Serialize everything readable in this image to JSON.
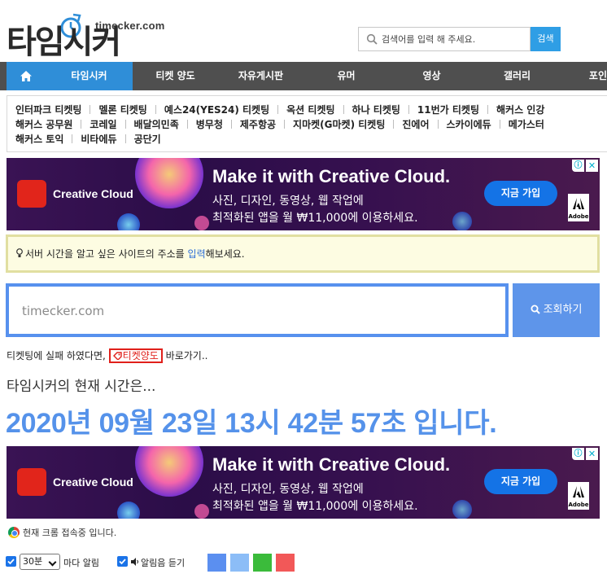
{
  "header": {
    "logo_domain": "timecker.com",
    "logo_text": "타임시커",
    "search_placeholder": "검색어를 입력 해 주세요.",
    "search_button": "검색"
  },
  "nav": {
    "home_icon": "home-icon",
    "items": [
      "타임시커",
      "티켓 양도",
      "자유게시판",
      "유머",
      "영상",
      "갤러리",
      "포인"
    ]
  },
  "ticket_sites": {
    "rows": [
      [
        "인터파크 티켓팅",
        "멜론 티켓팅",
        "예스24(YES24) 티켓팅",
        "옥션 티켓팅",
        "하나 티켓팅",
        "11번가 티켓팅",
        "해커스 인강"
      ],
      [
        "해커스 공무원",
        "코레일",
        "배달의민족",
        "병무청",
        "제주항공",
        "지마켓(G마켓) 티켓팅",
        "진에어",
        "스카이에듀",
        "메가스터"
      ],
      [
        "해커스 토익",
        "비타에듀",
        "공단기"
      ]
    ]
  },
  "ad": {
    "brand": "Creative Cloud",
    "title": "Make it with Creative Cloud.",
    "line1": "사진, 디자인, 동영상, 웹 작업에",
    "line2": "최적화된 앱을 월 ₩11,000에 이용하세요.",
    "cta": "지금 가입",
    "adobe": "Adobe",
    "info_icon": "ⓘ",
    "close_icon": "✕"
  },
  "notice": {
    "icon": "lightbulb-icon",
    "before": "서버 시간을 알고 싶은 사이트의 주소를 ",
    "link": "입력",
    "after": "해보세요."
  },
  "url_search": {
    "placeholder": "timecker.com",
    "button": "조회하기"
  },
  "ticket_line": {
    "before": "티켓팅에 실패 하였다면, ",
    "badge": "티켓양도",
    "after": " 바로가기.."
  },
  "time": {
    "label": "타임시커의 현재 시간은...",
    "value": "2020년 09월 23일 13시 42분 57초 입니다."
  },
  "browser_status": "현재 크롬 접속중 입니다.",
  "controls": {
    "interval_selected": "30분",
    "interval_suffix": "마다 알림",
    "sound_label": "알림음 듣기",
    "swatch_colors": [
      "#5b8ff0",
      "#8cbdf7",
      "#3bbb3b",
      "#f25858"
    ]
  }
}
